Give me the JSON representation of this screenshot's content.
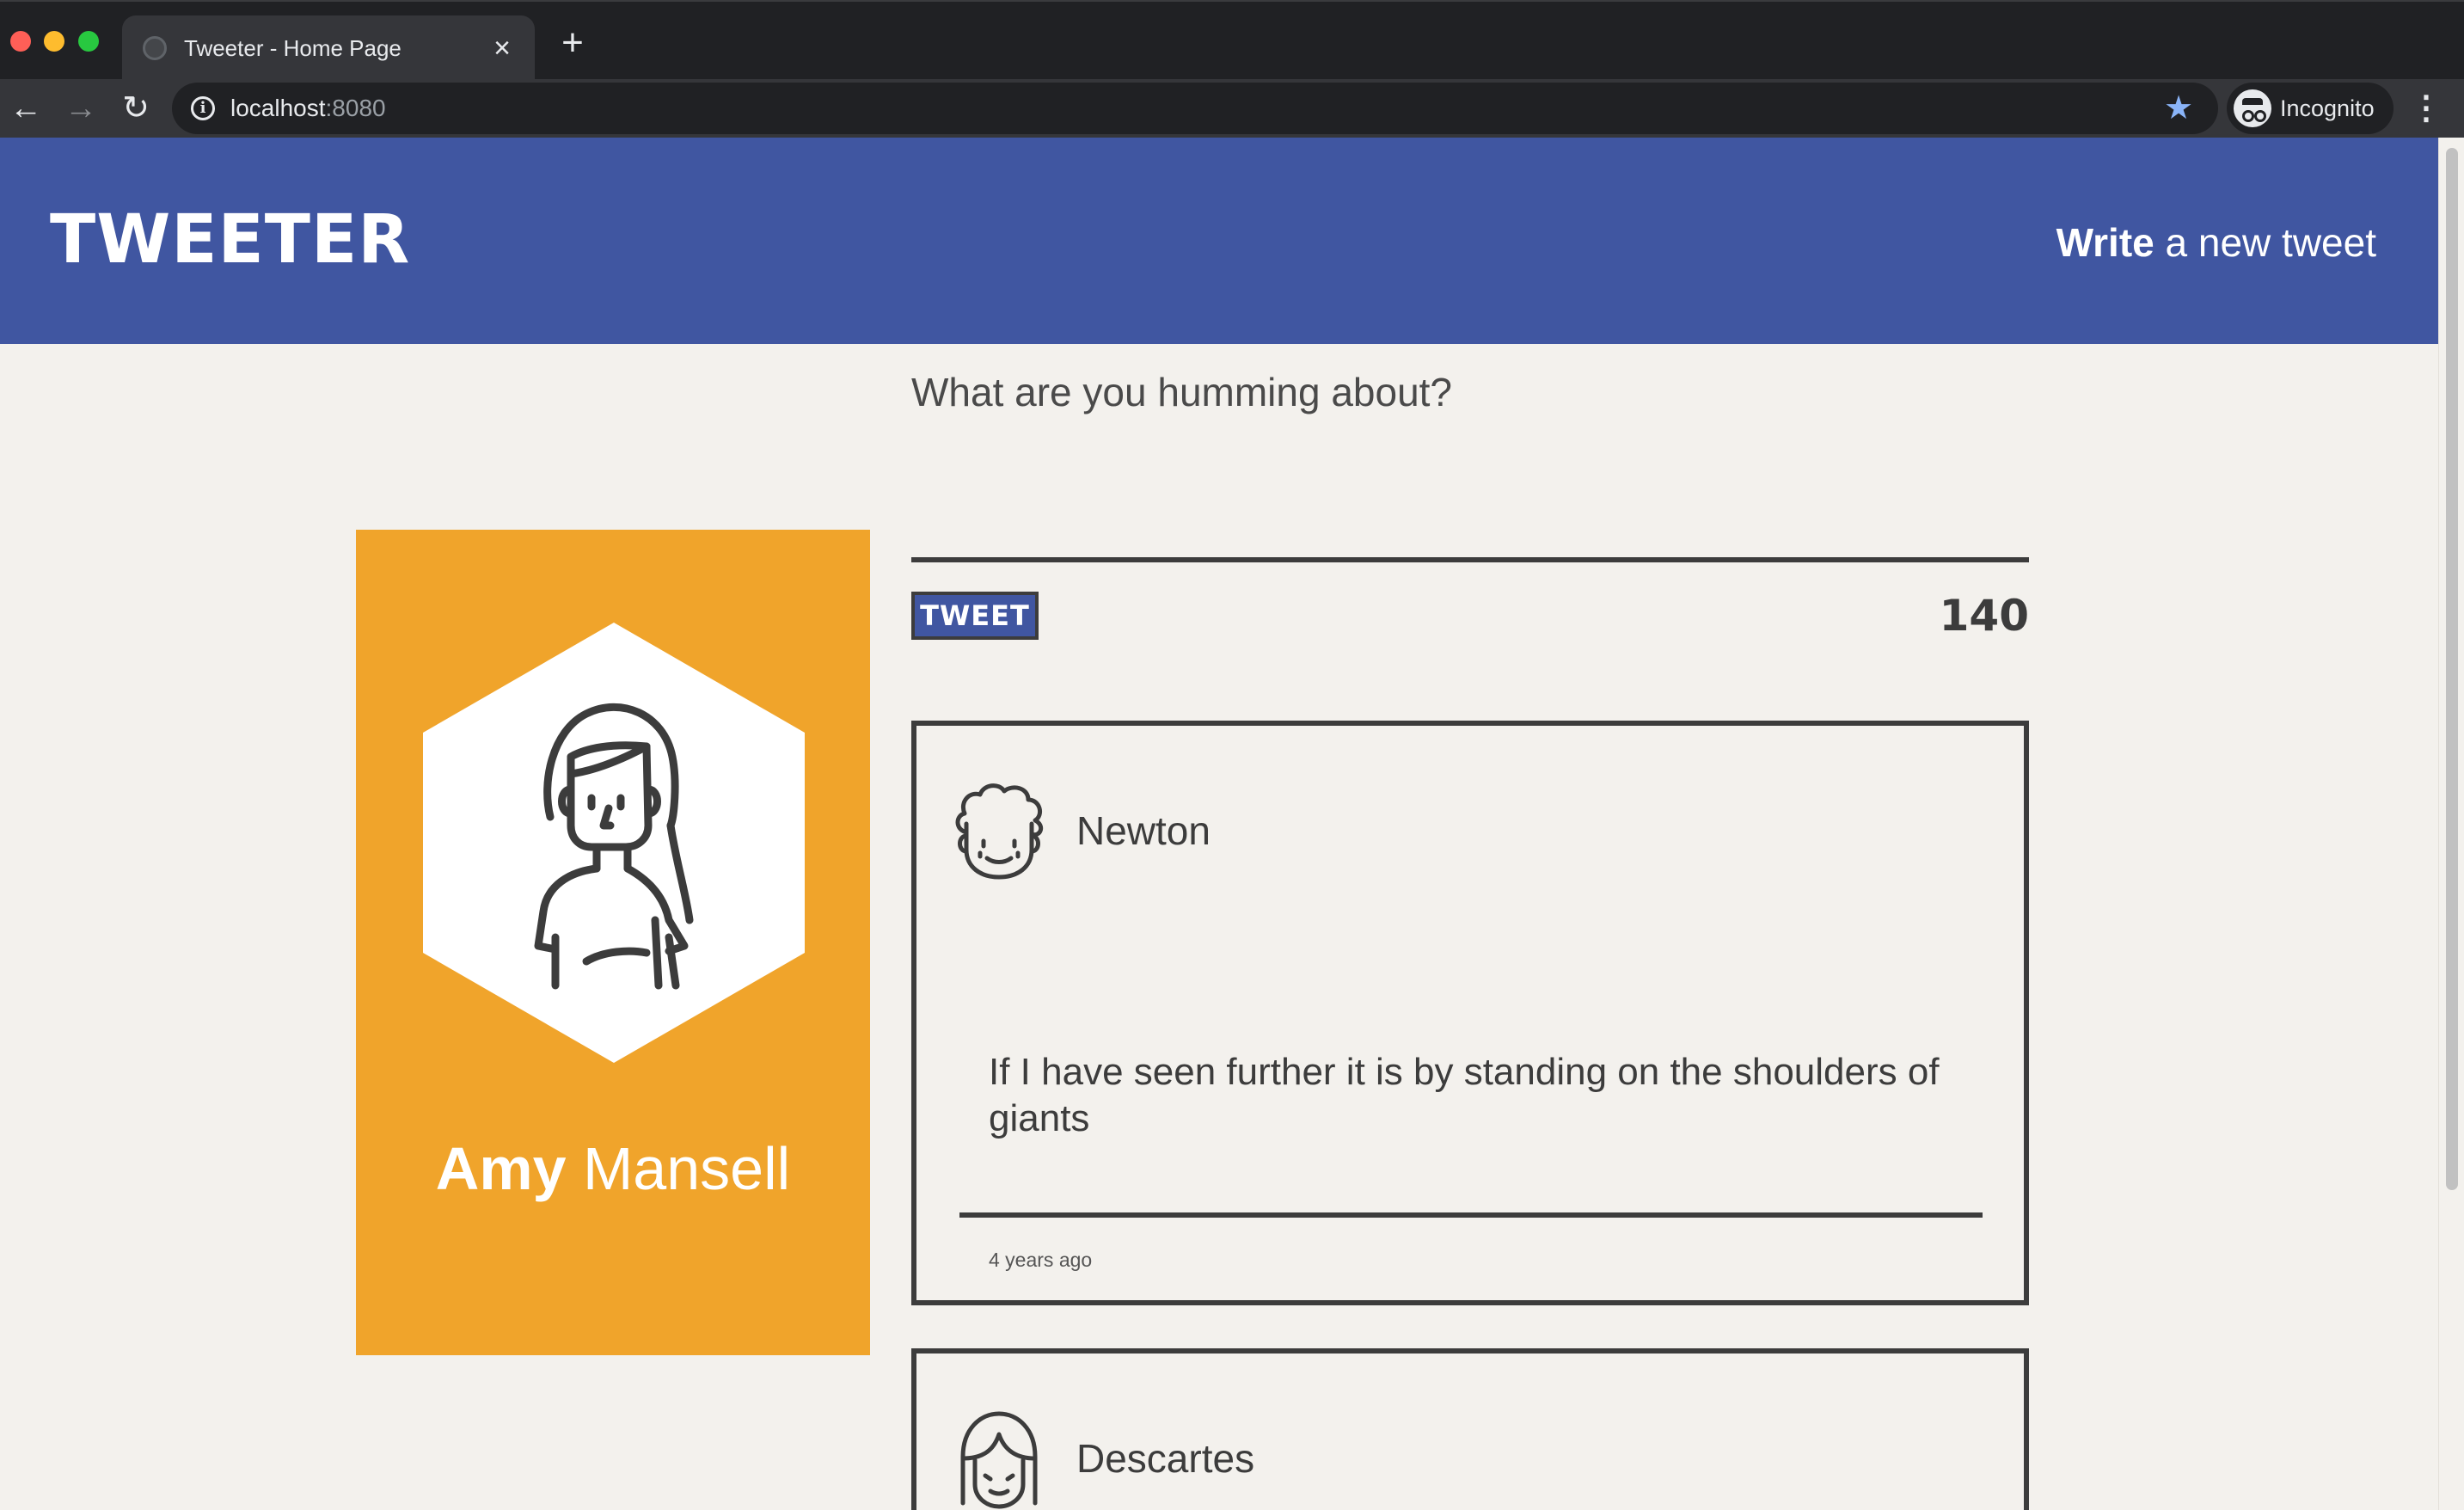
{
  "browser": {
    "tab_title": "Tweeter - Home Page",
    "tab_close": "×",
    "new_tab": "+",
    "url_host": "localhost",
    "url_port": ":8080",
    "profile_label": "Incognito",
    "back": "←",
    "forward": "→",
    "reload": "↻",
    "star": "★",
    "menu": "⋮",
    "info": "i"
  },
  "header": {
    "logo": "TWEETER",
    "write_bold": "Write",
    "write_rest": " a new tweet"
  },
  "composer": {
    "prompt": "What are you humming about?",
    "tweet_button": "TWEET",
    "char_count": "140"
  },
  "profile": {
    "first_name": "Amy",
    "last_name": " Mansell"
  },
  "tweets": [
    {
      "author": "Newton",
      "text": "If I have seen further it is by standing on the shoulders of giants",
      "time": "4 years ago"
    },
    {
      "author": "Descartes"
    }
  ],
  "colors": {
    "header_bg": "#4056a1",
    "page_bg": "#f3f1ed",
    "card_bg": "#f0a42b",
    "ink": "#3c3c3c"
  }
}
